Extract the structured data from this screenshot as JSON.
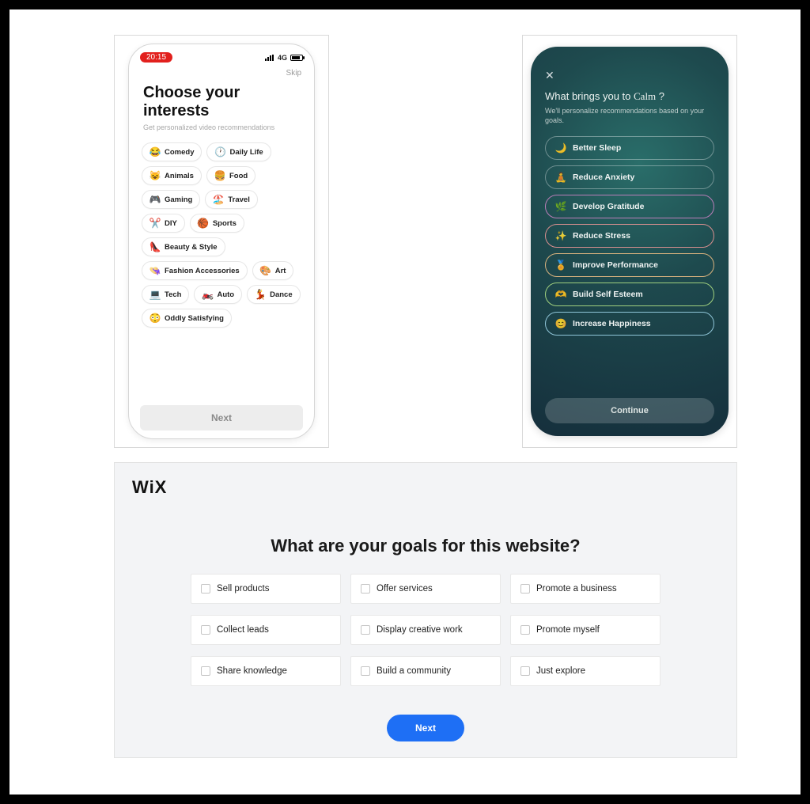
{
  "interests": {
    "status_time": "20:15",
    "network_label": "4G",
    "skip_label": "Skip",
    "title_line1": "Choose your",
    "title_line2": "interests",
    "subtitle": "Get personalized video recommendations",
    "next_label": "Next",
    "pills": [
      {
        "label": "Comedy",
        "emoji": "😂"
      },
      {
        "label": "Daily Life",
        "emoji": "🕐"
      },
      {
        "label": "Animals",
        "emoji": "😺"
      },
      {
        "label": "Food",
        "emoji": "🍔"
      },
      {
        "label": "Gaming",
        "emoji": "🎮"
      },
      {
        "label": "Travel",
        "emoji": "🏖️"
      },
      {
        "label": "DIY",
        "emoji": "✂️"
      },
      {
        "label": "Sports",
        "emoji": "🏀"
      },
      {
        "label": "Beauty & Style",
        "emoji": "👠"
      },
      {
        "label": "Fashion Accessories",
        "emoji": "👒"
      },
      {
        "label": "Art",
        "emoji": "🎨"
      },
      {
        "label": "Tech",
        "emoji": "💻"
      },
      {
        "label": "Auto",
        "emoji": "🏍️"
      },
      {
        "label": "Dance",
        "emoji": "💃"
      },
      {
        "label": "Oddly Satisfying",
        "emoji": "😳"
      }
    ]
  },
  "calm": {
    "title_prefix": "What brings you to ",
    "brand": "Calm",
    "title_suffix": " ?",
    "subtitle": "We'll personalize recommendations based on your goals.",
    "continue_label": "Continue",
    "goals": [
      {
        "label": "Better Sleep",
        "icon": "🌙"
      },
      {
        "label": "Reduce Anxiety",
        "icon": "🧘"
      },
      {
        "label": "Develop Gratitude",
        "icon": "🌿"
      },
      {
        "label": "Reduce Stress",
        "icon": "✨"
      },
      {
        "label": "Improve Performance",
        "icon": "🏅"
      },
      {
        "label": "Build Self Esteem",
        "icon": "🫶"
      },
      {
        "label": "Increase Happiness",
        "icon": "😊"
      }
    ]
  },
  "wix": {
    "logo": "WiX",
    "title": "What are your goals for this website?",
    "next_label": "Next",
    "options": [
      "Sell products",
      "Offer services",
      "Promote a business",
      "Collect leads",
      "Display creative work",
      "Promote myself",
      "Share knowledge",
      "Build a community",
      "Just explore"
    ]
  }
}
